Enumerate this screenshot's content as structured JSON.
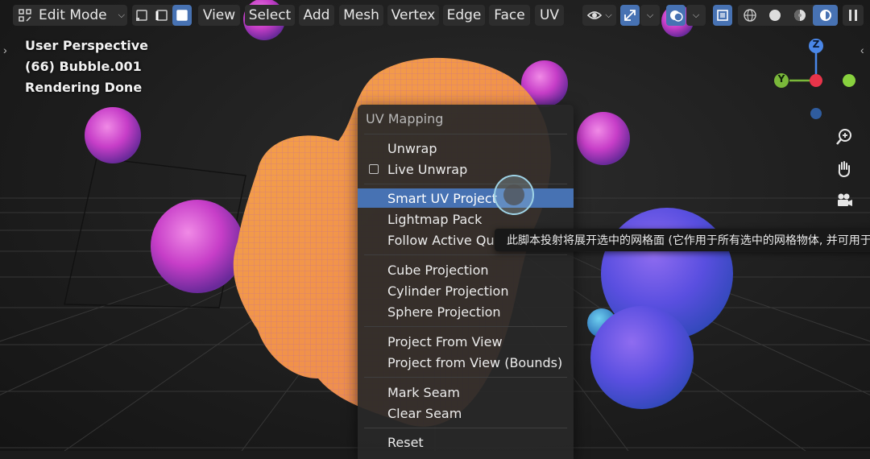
{
  "header": {
    "mode": {
      "icon": "edit-mode-icon",
      "label": "Edit Mode"
    },
    "select_modes": [
      "vertex-select-icon",
      "edge-select-icon",
      "face-select-icon"
    ],
    "active_select_mode": 2,
    "menus": [
      "View",
      "Select",
      "Add",
      "Mesh",
      "Vertex",
      "Edge",
      "Face",
      "UV"
    ],
    "right_icons": [
      "visibility-icon",
      "gizmo-icon",
      "overlay-icon",
      "xray-icon",
      "wireframe-shading-icon",
      "solid-shading-icon",
      "material-shading-icon",
      "rendered-shading-icon",
      "pause-icon"
    ]
  },
  "overlay": {
    "line1": "User Perspective",
    "line2": "(66) Bubble.001",
    "line3": "Rendering Done"
  },
  "gizmo": {
    "z": "Z",
    "y": "Y"
  },
  "accent": "#4772b3",
  "menu": {
    "title": "UV Mapping",
    "items": [
      {
        "label": "Unwrap"
      },
      {
        "label": "Live Unwrap",
        "checkbox": true,
        "checked": false
      },
      {
        "label": "Smart UV Project",
        "highlighted": true
      },
      {
        "label": "Lightmap Pack"
      },
      {
        "label": "Follow Active Quads"
      },
      {
        "label": "Cube Projection"
      },
      {
        "label": "Cylinder Projection"
      },
      {
        "label": "Sphere Projection"
      },
      {
        "label": "Project From View"
      },
      {
        "label": "Project from View (Bounds)"
      },
      {
        "label": "Mark Seam"
      },
      {
        "label": "Clear Seam"
      },
      {
        "label": "Reset"
      }
    ]
  },
  "tooltip": {
    "text": "此脚本投射将展开选中的网格面 (它作用于所有选中的网格物体, 并可用于"
  }
}
